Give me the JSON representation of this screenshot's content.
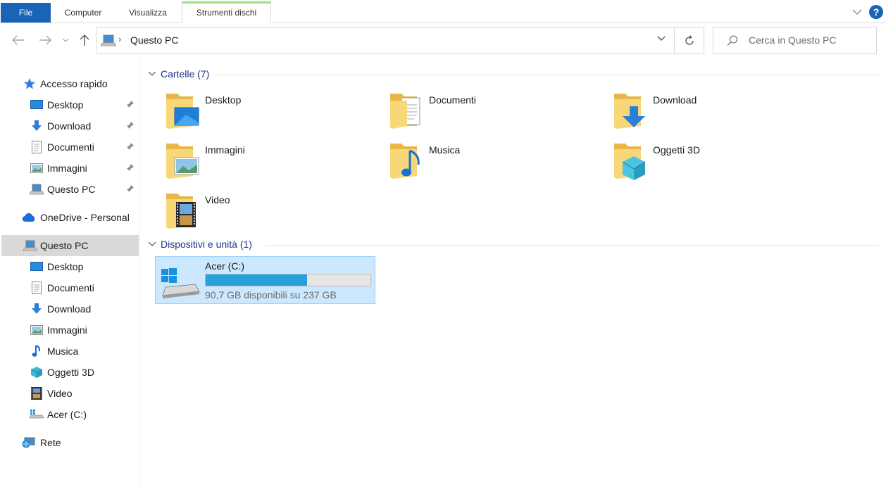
{
  "ribbon": {
    "tabs": [
      "File",
      "Computer",
      "Visualizza",
      "Strumenti dischi"
    ],
    "help": "?"
  },
  "address": {
    "path": "Questo PC",
    "separator": "›",
    "search_placeholder": "Cerca in Questo PC"
  },
  "sidebar": {
    "quick_access": "Accesso rapido",
    "quick_items": [
      "Desktop",
      "Download",
      "Documenti",
      "Immagini",
      "Questo PC"
    ],
    "onedrive": "OneDrive - Personal",
    "this_pc": "Questo PC",
    "pc_items": [
      "Desktop",
      "Documenti",
      "Download",
      "Immagini",
      "Musica",
      "Oggetti 3D",
      "Video",
      "Acer (C:)"
    ],
    "network": "Rete"
  },
  "content": {
    "folders_header": "Cartelle (7)",
    "folders": [
      "Desktop",
      "Documenti",
      "Download",
      "Immagini",
      "Musica",
      "Oggetti 3D",
      "Video"
    ],
    "devices_header": "Dispositivi e unità (1)",
    "drive": {
      "name": "Acer (C:)",
      "free_text": "90,7 GB disponibili su 237 GB",
      "used_fraction": 0.617
    }
  },
  "colors": {
    "accent": "#1a64b7",
    "group_header": "#1e3287",
    "selection": "#cce8ff",
    "drive_bar": "#26a0da"
  }
}
